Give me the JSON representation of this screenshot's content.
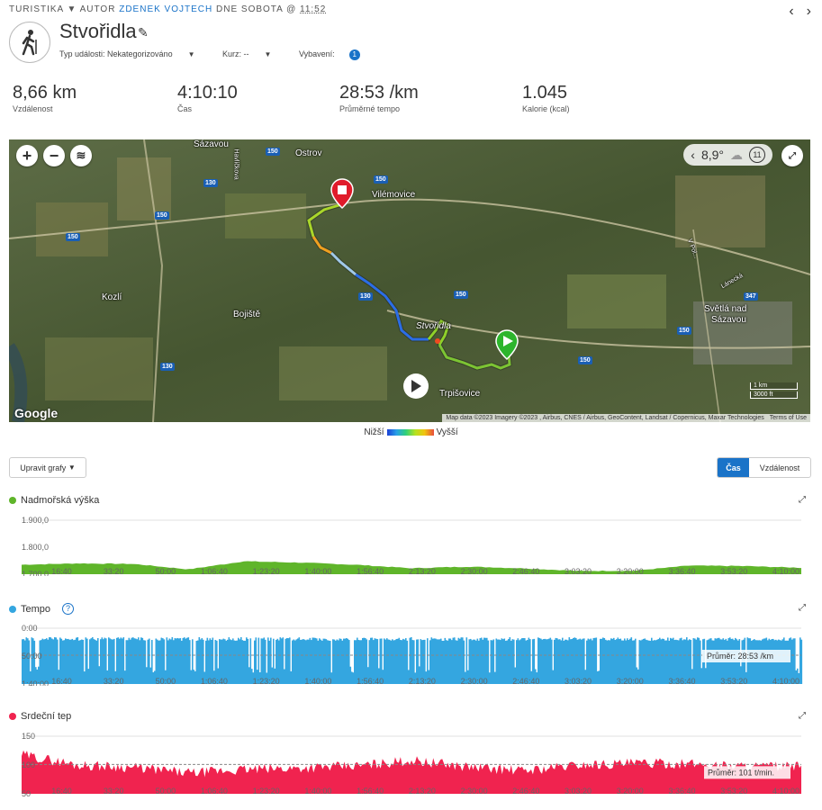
{
  "header": {
    "activity_type": "TURISTIKA",
    "author_prefix": "AUTOR",
    "author_name": "ZDENEK VOJTECH",
    "date_text": "DNE SOBOTA @",
    "time": "11:52",
    "title": "Stvořidla",
    "event_type_label": "Typ události: Nekategorizováno",
    "course_label": "Kurz: --",
    "equipment_label": "Vybavení:",
    "equipment_count": "1"
  },
  "stats": [
    {
      "value": "8,66 km",
      "label": "Vzdálenost"
    },
    {
      "value": "4:10:10",
      "label": "Čas"
    },
    {
      "value": "28:53 /km",
      "label": "Průměrné tempo"
    },
    {
      "value": "1.045",
      "label": "Kalorie (kcal)"
    }
  ],
  "map": {
    "weather_temp": "8,9°",
    "weather_wind": "11",
    "places": [
      "Sázavou",
      "Ostrov",
      "Vilémovice",
      "Kozlí",
      "Bojiště",
      "Stvořidla",
      "Trpišovice",
      "Světlá nad",
      "Sázavou",
      "Lánecká",
      "Havlíčkova",
      "V Pol..."
    ],
    "roads": [
      "150",
      "150",
      "130",
      "150",
      "150",
      "130",
      "150",
      "150",
      "347",
      "150",
      "130"
    ],
    "scale_km": "1 km",
    "scale_ft": "3000 ft",
    "attribution": "Map data ©2023 Imagery ©2023 , Airbus, CNES / Airbus, GeoContent, Landsat / Copernicus, Maxar Technologies",
    "terms": "Terms of Use",
    "google": "Google"
  },
  "legend": {
    "low": "Nižší",
    "high": "Vyšší"
  },
  "controls": {
    "edit_charts": "Upravit grafy",
    "time_tab": "Čas",
    "distance_tab": "Vzdálenost"
  },
  "x_ticks": [
    "16:40",
    "33:20",
    "50:00",
    "1:06:40",
    "1:23:20",
    "1:40:00",
    "1:56:40",
    "2:13:20",
    "2:30:00",
    "2:46:40",
    "3:03:20",
    "3:20:00",
    "3:36:40",
    "3:53:20",
    "4:10:00"
  ],
  "charts": {
    "elevation": {
      "title": "Nadmořská výška",
      "color": "#5fb52a",
      "y_labels": [
        "1.900,0",
        "1.800,0",
        "1.700,0"
      ]
    },
    "pace": {
      "title": "Tempo",
      "color": "#34a6e0",
      "y_labels": [
        "0:00",
        "50:00",
        "1:40:00"
      ],
      "avg_label": "Průměr: 28:53 /km"
    },
    "heart": {
      "title": "Srdeční tep",
      "color": "#f0234f",
      "y_labels": [
        "150",
        "100",
        "50"
      ],
      "avg_label": "Průměr: 101 t/min."
    }
  },
  "chart_data": [
    {
      "type": "area",
      "title": "Nadmořská výška",
      "x_unit": "time",
      "ylim": [
        1700,
        1900
      ],
      "x": [
        "16:40",
        "33:20",
        "50:00",
        "1:06:40",
        "1:23:20",
        "1:40:00",
        "1:56:40",
        "2:13:20",
        "2:30:00",
        "2:46:40",
        "3:03:20",
        "3:20:00",
        "3:36:40",
        "3:53:20",
        "4:10:00"
      ],
      "values": [
        1735,
        1740,
        1738,
        1718,
        1748,
        1743,
        1735,
        1722,
        1728,
        1722,
        1712,
        1713,
        1732,
        1730,
        1724
      ]
    },
    {
      "type": "area",
      "title": "Tempo",
      "x_unit": "time",
      "x": [
        "16:40",
        "33:20",
        "50:00",
        "1:06:40",
        "1:23:20",
        "1:40:00",
        "1:56:40",
        "2:13:20",
        "2:30:00",
        "2:46:40",
        "3:03:20",
        "3:20:00",
        "3:36:40",
        "3:53:20",
        "4:10:00"
      ],
      "average": "28:53 /km"
    },
    {
      "type": "area",
      "title": "Srdeční tep",
      "x_unit": "time",
      "ylim": [
        50,
        150
      ],
      "x": [
        "16:40",
        "33:20",
        "50:00",
        "1:06:40",
        "1:23:20",
        "1:40:00",
        "1:56:40",
        "2:13:20",
        "2:30:00",
        "2:46:40",
        "3:03:20",
        "3:20:00",
        "3:36:40",
        "3:53:20",
        "4:10:00"
      ],
      "values": [
        118,
        100,
        96,
        86,
        92,
        95,
        98,
        108,
        97,
        90,
        100,
        103,
        102,
        98,
        97
      ],
      "average": 101
    }
  ]
}
